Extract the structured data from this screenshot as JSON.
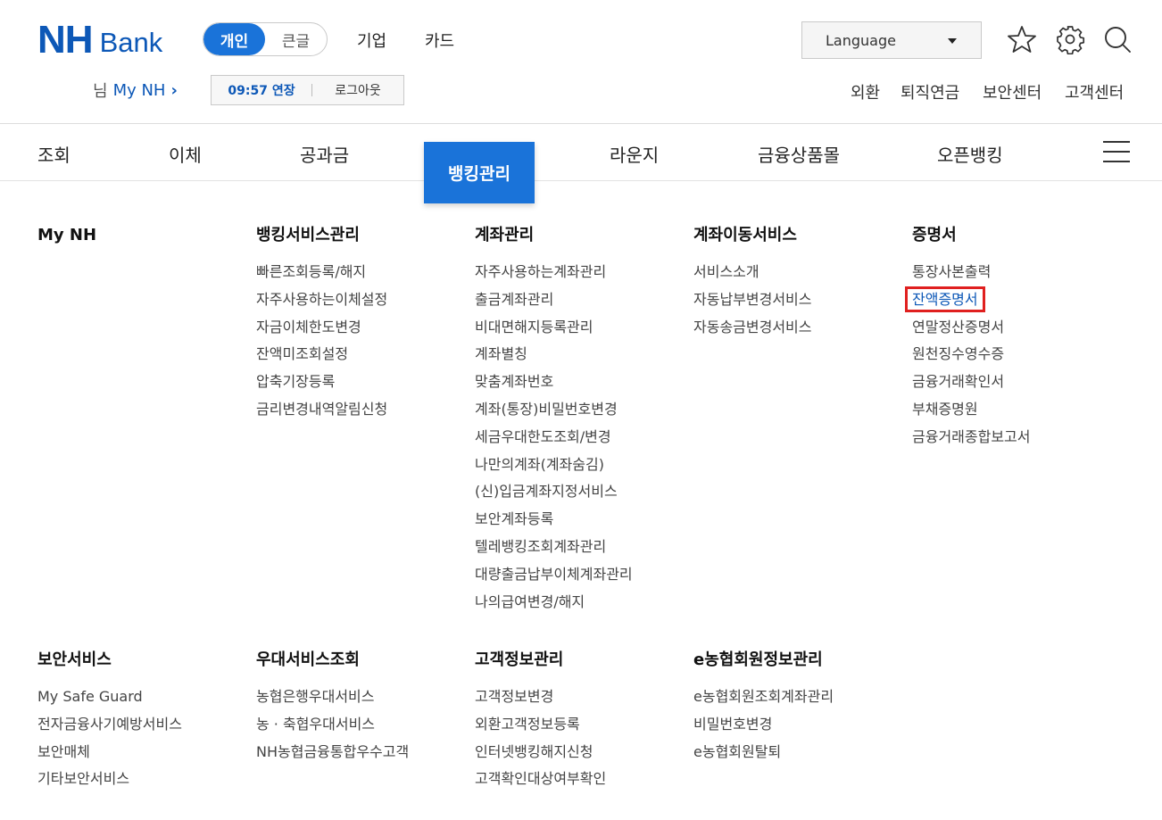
{
  "header": {
    "logo_nh": "NH",
    "logo_bank": "Bank",
    "mode_personal": "개인",
    "mode_large": "큰글",
    "top_links": [
      "기업",
      "카드"
    ],
    "language_label": "Language",
    "user_prefix": "님",
    "user_name": "My NH",
    "session_time": "09:57 연장",
    "logout": "로그아웃",
    "util_links": [
      "외환",
      "퇴직연금",
      "보안센터",
      "고객센터"
    ]
  },
  "gnb": {
    "items": [
      "조회",
      "이체",
      "공과금",
      "뱅킹관리",
      "라운지",
      "금융상품몰",
      "오픈뱅킹"
    ],
    "active": "뱅킹관리"
  },
  "menu": {
    "row1": [
      {
        "title": "My NH",
        "items": []
      },
      {
        "title": "뱅킹서비스관리",
        "items": [
          "빠른조회등록/해지",
          "자주사용하는이체설정",
          "자금이체한도변경",
          "잔액미조회설정",
          "압축기장등록",
          "금리변경내역알림신청"
        ]
      },
      {
        "title": "계좌관리",
        "items": [
          "자주사용하는계좌관리",
          "출금계좌관리",
          "비대면해지등록관리",
          "계좌별칭",
          "맞춤계좌번호",
          "계좌(통장)비밀번호변경",
          "세금우대한도조회/변경",
          "나만의계좌(계좌숨김)",
          "(신)입금계좌지정서비스",
          "보안계좌등록",
          "텔레뱅킹조회계좌관리",
          "대량출금납부이체계좌관리",
          "나의급여변경/해지"
        ]
      },
      {
        "title": "계좌이동서비스",
        "items": [
          "서비스소개",
          "자동납부변경서비스",
          "자동송금변경서비스"
        ]
      },
      {
        "title": "증명서",
        "items": [
          "통장사본출력",
          "잔액증명서",
          "연말정산증명서",
          "원천징수영수증",
          "금융거래확인서",
          "부채증명원",
          "금융거래종합보고서"
        ]
      }
    ],
    "row2": [
      {
        "title": "보안서비스",
        "items": [
          "My Safe Guard",
          "전자금융사기예방서비스",
          "보안매체",
          "기타보안서비스"
        ]
      },
      {
        "title": "우대서비스조회",
        "items": [
          "농협은행우대서비스",
          "농 · 축협우대서비스",
          "NH농협금융통합우수고객"
        ]
      },
      {
        "title": "고객정보관리",
        "items": [
          "고객정보변경",
          "외환고객정보등록",
          "인터넷뱅킹해지신청",
          "고객확인대상여부확인"
        ]
      },
      {
        "title": "e농협회원정보관리",
        "items": [
          "e농협회원조회계좌관리",
          "비밀번호변경",
          "e농협회원탈퇴"
        ]
      }
    ],
    "highlighted_item": "잔액증명서"
  },
  "colors": {
    "brand": "#0d58b7",
    "active": "#1a73d9",
    "highlight_border": "#e0201f"
  }
}
